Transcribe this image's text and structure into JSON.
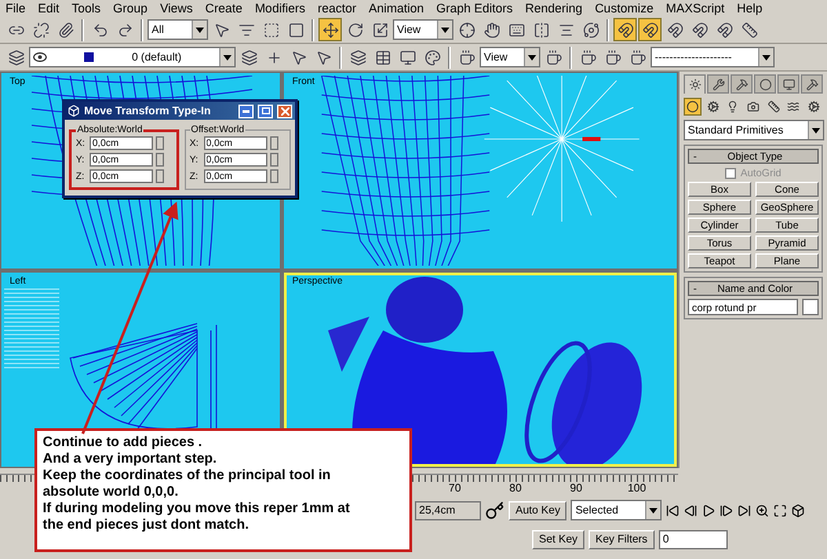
{
  "menu": [
    "File",
    "Edit",
    "Tools",
    "Group",
    "Views",
    "Create",
    "Modifiers",
    "reactor",
    "Animation",
    "Graph Editors",
    "Rendering",
    "Customize",
    "MAXScript",
    "Help"
  ],
  "toolbar_main": [
    {
      "kind": "tool",
      "selected": false
    },
    {
      "kind": "tool",
      "selected": false
    },
    {
      "kind": "tool",
      "selected": false
    },
    {
      "kind": "sep"
    },
    {
      "kind": "tool",
      "selected": false
    },
    {
      "kind": "tool",
      "selected": false
    },
    {
      "kind": "sep"
    },
    {
      "kind": "dropdown",
      "value": "All"
    },
    {
      "kind": "tool",
      "selected": false
    },
    {
      "kind": "tool",
      "selected": false
    },
    {
      "kind": "tool",
      "selected": false
    },
    {
      "kind": "tool",
      "selected": false
    },
    {
      "kind": "sep"
    },
    {
      "kind": "tool",
      "selected": true
    },
    {
      "kind": "tool",
      "selected": false
    },
    {
      "kind": "tool",
      "selected": false
    },
    {
      "kind": "dropdown",
      "value": "View"
    },
    {
      "kind": "tool",
      "selected": false
    },
    {
      "kind": "tool",
      "selected": false
    },
    {
      "kind": "tool",
      "selected": false
    },
    {
      "kind": "tool",
      "selected": false
    },
    {
      "kind": "tool",
      "selected": false
    },
    {
      "kind": "tool",
      "selected": false
    },
    {
      "kind": "sep"
    },
    {
      "kind": "tool",
      "selected": true
    },
    {
      "kind": "tool",
      "selected": true
    },
    {
      "kind": "tool",
      "selected": false
    },
    {
      "kind": "tool",
      "selected": false
    },
    {
      "kind": "tool",
      "selected": false
    },
    {
      "kind": "tool",
      "selected": false
    }
  ],
  "toolbar_layers": [
    {
      "kind": "tool",
      "selected": false
    },
    {
      "kind": "layer",
      "value": "0 (default)"
    },
    {
      "kind": "tool",
      "selected": false
    },
    {
      "kind": "tool",
      "selected": false
    },
    {
      "kind": "tool",
      "selected": false
    },
    {
      "kind": "tool",
      "selected": false
    },
    {
      "kind": "sep"
    },
    {
      "kind": "tool",
      "selected": false
    },
    {
      "kind": "tool",
      "selected": false
    },
    {
      "kind": "tool",
      "selected": false
    },
    {
      "kind": "tool",
      "selected": false
    },
    {
      "kind": "sep"
    },
    {
      "kind": "tool",
      "selected": false
    },
    {
      "kind": "dropdown",
      "value": "View"
    },
    {
      "kind": "tool",
      "selected": false
    },
    {
      "kind": "sep"
    },
    {
      "kind": "tool",
      "selected": false
    },
    {
      "kind": "tool",
      "selected": false
    },
    {
      "kind": "tool",
      "selected": false
    },
    {
      "kind": "dropdown",
      "value": "---------------------"
    }
  ],
  "viewports": [
    {
      "kind": "top",
      "label": "Top",
      "active": false
    },
    {
      "kind": "front",
      "label": "Front",
      "active": false
    },
    {
      "kind": "left",
      "label": "Left",
      "active": false
    },
    {
      "kind": "perspective",
      "label": "Perspective",
      "active": true
    }
  ],
  "dialog": {
    "title": "Move Transform Type-In",
    "groups": [
      {
        "label": "Absolute:World",
        "highlighted": true,
        "fields": [
          {
            "axis": "X:",
            "value": "0,0cm"
          },
          {
            "axis": "Y:",
            "value": "0,0cm"
          },
          {
            "axis": "Z:",
            "value": "0,0cm"
          }
        ]
      },
      {
        "label": "Offset:World",
        "highlighted": false,
        "fields": [
          {
            "axis": "X:",
            "value": "0,0cm"
          },
          {
            "axis": "Y:",
            "value": "0,0cm"
          },
          {
            "axis": "Z:",
            "value": "0,0cm"
          }
        ]
      }
    ]
  },
  "command_panel": {
    "tabs": [
      {
        "selected": true
      },
      {
        "selected": false
      },
      {
        "selected": false
      },
      {
        "selected": false
      },
      {
        "selected": false
      },
      {
        "selected": false
      }
    ],
    "categories": [
      {
        "selected": true
      },
      {
        "selected": false
      },
      {
        "selected": false
      },
      {
        "selected": false
      },
      {
        "selected": false
      },
      {
        "selected": false
      },
      {
        "selected": false
      }
    ],
    "type_dropdown": "Standard Primitives",
    "object_type": {
      "title": "Object Type",
      "collapse": "-",
      "autogrid": {
        "label": "AutoGrid",
        "checked": false,
        "disabled": true
      },
      "buttons": [
        "Box",
        "Cone",
        "Sphere",
        "GeoSphere",
        "Cylinder",
        "Tube",
        "Torus",
        "Pyramid",
        "Teapot",
        "Plane"
      ]
    },
    "name_and_color": {
      "title": "Name and Color",
      "collapse": "-",
      "name": "corp rotund pr",
      "color": "#ffffff"
    }
  },
  "timeline": {
    "ticks": [
      "70",
      "80",
      "90",
      "100"
    ]
  },
  "status": {
    "coordinate": "25,4cm",
    "auto_key": "Auto Key",
    "key_mode": "Selected",
    "set_key": "Set Key",
    "key_filters": "Key Filters",
    "frame": "0"
  },
  "annotation": {
    "lines": [
      "Continue to add pieces .",
      "And a very important step.",
      "Keep the coordinates of the principal tool in",
      "absolute world 0,0,0.",
      "If during modeling you move this reper 1mm at",
      "the end pieces just dont match."
    ]
  }
}
